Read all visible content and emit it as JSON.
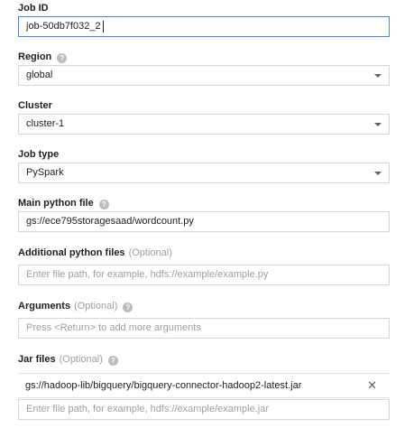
{
  "job_id": {
    "label": "Job ID",
    "value": "job-50db7f032_2"
  },
  "region": {
    "label": "Region",
    "value": "global",
    "help_icon": "question-circle-icon"
  },
  "cluster": {
    "label": "Cluster",
    "value": "cluster-1"
  },
  "job_type": {
    "label": "Job type",
    "value": "PySpark"
  },
  "main_python_file": {
    "label": "Main python file",
    "value": "gs://ece795storagesaad/wordcount.py",
    "help_icon": "question-circle-icon"
  },
  "additional_python_files": {
    "label": "Additional python files",
    "optional": "(Optional)",
    "placeholder": "Enter file path, for example, hdfs://example/example.py"
  },
  "arguments": {
    "label": "Arguments",
    "optional": "(Optional)",
    "placeholder": "Press <Return> to add more arguments",
    "help_icon": "question-circle-icon"
  },
  "jar_files": {
    "label": "Jar files",
    "optional": "(Optional)",
    "help_icon": "question-circle-icon",
    "items": [
      "gs://hadoop-lib/bigquery/bigquery-connector-hadoop2-latest.jar"
    ],
    "remove_icon": "close-icon",
    "placeholder": "Enter file path, for example, hdfs://example/example.jar"
  },
  "help_glyph": "?",
  "remove_glyph": "✕"
}
